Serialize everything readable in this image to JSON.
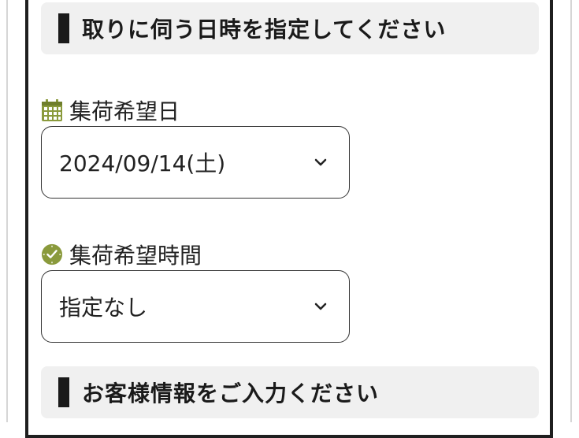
{
  "pickup_section": {
    "title": "取りに伺う日時を指定してください"
  },
  "pickup_date": {
    "label": "集荷希望日",
    "icon": "calendar-icon",
    "value": "2024/09/14(土)"
  },
  "pickup_time": {
    "label": "集荷希望時間",
    "icon": "clock-icon",
    "value": "指定なし"
  },
  "customer_section": {
    "title": "お客様情報をご入力ください"
  },
  "colors": {
    "icon_green": "#8a9a3c",
    "header_bg": "#f0f0f0",
    "border": "#333333"
  }
}
